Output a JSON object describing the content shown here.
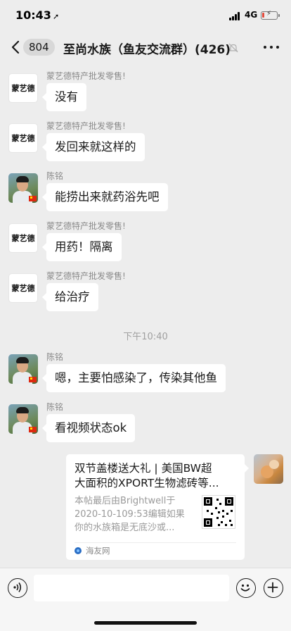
{
  "status_bar": {
    "time": "10:43",
    "location_glyph": "➚",
    "network": "4G",
    "battery_level": 0.15,
    "charging_glyph": "⚡"
  },
  "header": {
    "back_count": "804",
    "title": "至尚水族（鱼友交流群）(426)",
    "mute_icon": "bell-off-icon",
    "more_icon": "more-dots-icon"
  },
  "messages": [
    {
      "sender": "蒙艺德特产批发零售!",
      "text": "没有",
      "avatar": "蒙艺德"
    },
    {
      "sender": "蒙艺德特产批发零售!",
      "text": "发回来就这样的",
      "avatar": "蒙艺德"
    },
    {
      "sender": "陈铭",
      "text": "能捞出来就药浴先吧"
    },
    {
      "sender": "蒙艺德特产批发零售!",
      "text": "用药！隔离",
      "avatar": "蒙艺德"
    },
    {
      "sender": "蒙艺德特产批发零售!",
      "text": "给治疗",
      "avatar": "蒙艺德"
    },
    {
      "sender": "陈铭",
      "text": "嗯，主要怕感染了，传染其他鱼"
    },
    {
      "sender": "陈铭",
      "text": "看视频状态ok"
    }
  ],
  "time_divider": "下午10:40",
  "link_card": {
    "title_line1": "双节盖楼送大礼 | 美国BW超",
    "title_line2": "大面积的XPORT生物滤砖等...",
    "desc_line1": "本帖最后由Brightwell于",
    "desc_line2": "2020-10-109:53编辑如果",
    "desc_line3": "你的水族箱是无底沙或...",
    "source": "海友网"
  },
  "input_bar": {
    "voice_icon": "voice-icon",
    "emoji_icon": "emoji-icon",
    "add_icon": "plus-icon"
  }
}
